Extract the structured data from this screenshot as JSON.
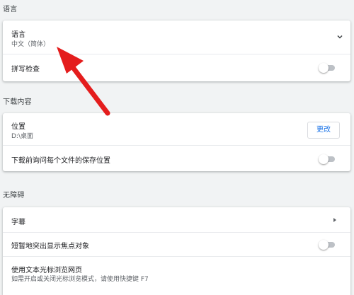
{
  "sections": {
    "language": {
      "title": "语言",
      "language_label": "语言",
      "language_value": "中文（简体）",
      "spellcheck_label": "拼写检查"
    },
    "downloads": {
      "title": "下载内容",
      "location_label": "位置",
      "location_value": "D:\\桌面",
      "change_button": "更改",
      "ask_label": "下载前询问每个文件的保存位置"
    },
    "accessibility": {
      "title": "无障碍",
      "captions_label": "字幕",
      "highlight_label": "短暂地突出显示焦点对象",
      "caret_label": "使用文本光标浏览网页",
      "caret_desc": "如需开启或关闭光标浏览模式，请使用快捷键 F7"
    }
  },
  "colors": {
    "background": "#f1f3f4",
    "card": "#ffffff",
    "accent": "#1a73e8",
    "arrow": "#e41d1d"
  },
  "icons": {
    "expand": "chevron-down-icon",
    "open_subpage": "triangle-right-icon",
    "annotation": "red-arrow"
  },
  "toggles": {
    "spellcheck": false,
    "ask_where_to_save": false,
    "focus_highlight": false
  }
}
